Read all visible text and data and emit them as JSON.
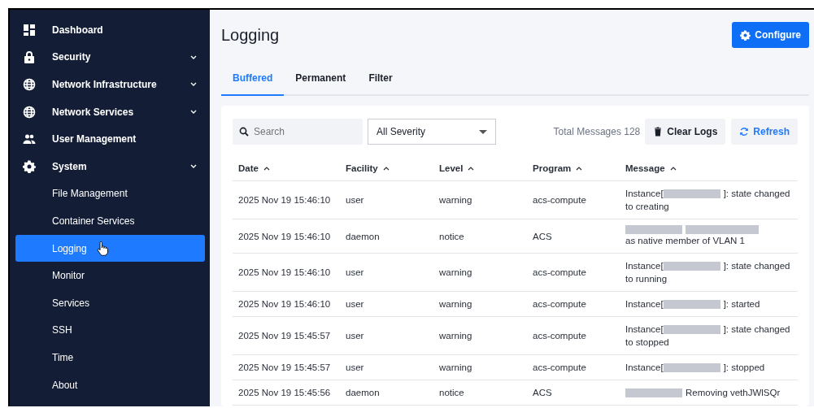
{
  "sidebar": {
    "items": [
      {
        "label": "Dashboard",
        "expandable": false,
        "selected": false
      },
      {
        "label": "Security",
        "expandable": true,
        "selected": false
      },
      {
        "label": "Network Infrastructure",
        "expandable": true,
        "selected": false
      },
      {
        "label": "Network Services",
        "expandable": true,
        "selected": false
      },
      {
        "label": "User Management",
        "expandable": false,
        "selected": false
      },
      {
        "label": "System",
        "expandable": true,
        "selected": false,
        "children": [
          {
            "label": "File Management",
            "selected": false
          },
          {
            "label": "Container Services",
            "selected": false
          },
          {
            "label": "Logging",
            "selected": true
          },
          {
            "label": "Monitor",
            "selected": false
          },
          {
            "label": "Services",
            "selected": false
          },
          {
            "label": "SSH",
            "selected": false
          },
          {
            "label": "Time",
            "selected": false
          },
          {
            "label": "About",
            "selected": false
          }
        ]
      }
    ]
  },
  "page": {
    "title": "Logging",
    "configure_button": "Configure"
  },
  "tabs": [
    {
      "label": "Buffered",
      "selected": true
    },
    {
      "label": "Permanent",
      "selected": false
    },
    {
      "label": "Filter",
      "selected": false
    }
  ],
  "toolbar": {
    "search": {
      "placeholder": "Search"
    },
    "severity": "All Severity",
    "total": "Total Messages 128",
    "clear_button": "Clear Logs",
    "refresh_button": "Refresh"
  },
  "table": {
    "columns": [
      "Date",
      "Facility",
      "Level",
      "Program",
      "Message"
    ],
    "rows": [
      {
        "date": "2025 Nov 19 15:46:10",
        "facility": "user",
        "level": "warning",
        "program": "acs-compute",
        "message": [
          [
            {
              "kind": "text",
              "text": "Instance["
            },
            {
              "kind": "redacted"
            },
            {
              "kind": "text",
              "text": "]: state changed"
            }
          ],
          [
            {
              "kind": "text",
              "text": "to creating"
            }
          ]
        ]
      },
      {
        "date": "2025 Nov 19 15:46:10",
        "facility": "daemon",
        "level": "notice",
        "program": "ACS",
        "message": [
          [
            {
              "kind": "redacted"
            },
            {
              "kind": "redacted"
            }
          ],
          [
            {
              "kind": "text",
              "text": "as native member of VLAN 1"
            }
          ]
        ]
      },
      {
        "date": "2025 Nov 19 15:46:10",
        "facility": "user",
        "level": "warning",
        "program": "acs-compute",
        "message": [
          [
            {
              "kind": "text",
              "text": "Instance["
            },
            {
              "kind": "redacted"
            },
            {
              "kind": "text",
              "text": "]: state changed"
            }
          ],
          [
            {
              "kind": "text",
              "text": "to running"
            }
          ]
        ]
      },
      {
        "date": "2025 Nov 19 15:46:10",
        "facility": "user",
        "level": "warning",
        "program": "acs-compute",
        "message": [
          [
            {
              "kind": "text",
              "text": "Instance["
            },
            {
              "kind": "redacted"
            },
            {
              "kind": "text",
              "text": "]: started"
            }
          ]
        ]
      },
      {
        "date": "2025 Nov 19 15:45:57",
        "facility": "user",
        "level": "warning",
        "program": "acs-compute",
        "message": [
          [
            {
              "kind": "text",
              "text": "Instance["
            },
            {
              "kind": "redacted"
            },
            {
              "kind": "text",
              "text": "]: state changed"
            }
          ],
          [
            {
              "kind": "text",
              "text": "to stopped"
            }
          ]
        ]
      },
      {
        "date": "2025 Nov 19 15:45:57",
        "facility": "user",
        "level": "warning",
        "program": "acs-compute",
        "message": [
          [
            {
              "kind": "text",
              "text": "Instance["
            },
            {
              "kind": "redacted"
            },
            {
              "kind": "text",
              "text": "]: stopped"
            }
          ]
        ]
      },
      {
        "date": "2025 Nov 19 15:45:56",
        "facility": "daemon",
        "level": "notice",
        "program": "ACS",
        "message": [
          [
            {
              "kind": "redacted"
            },
            {
              "kind": "text",
              "text": "Removing vethJWlSQr"
            }
          ]
        ]
      }
    ]
  }
}
